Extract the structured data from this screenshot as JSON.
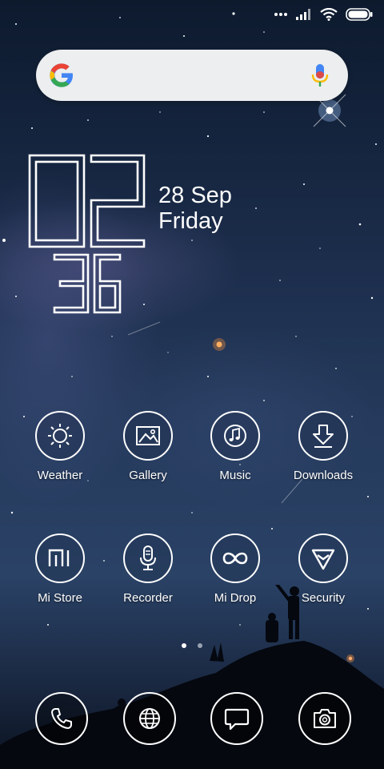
{
  "status_bar": {
    "signal": "signal-icon",
    "wifi": "wifi-icon",
    "battery": "battery-icon"
  },
  "search": {
    "placeholder": "",
    "logo": "google-logo-icon",
    "mic": "mic-icon"
  },
  "clock": {
    "hour": "02",
    "minute": "36",
    "day": "28 Sep",
    "weekday": "Friday"
  },
  "apps_row1": [
    {
      "label": "Weather",
      "icon": "weather-icon"
    },
    {
      "label": "Gallery",
      "icon": "gallery-icon"
    },
    {
      "label": "Music",
      "icon": "music-icon"
    },
    {
      "label": "Downloads",
      "icon": "downloads-icon"
    }
  ],
  "apps_row2": [
    {
      "label": "Mi Store",
      "icon": "mi-store-icon"
    },
    {
      "label": "Recorder",
      "icon": "recorder-icon"
    },
    {
      "label": "Mi Drop",
      "icon": "mi-drop-icon"
    },
    {
      "label": "Security",
      "icon": "security-icon"
    }
  ],
  "page_indicator": {
    "pages": 2,
    "current": 1
  },
  "dock": [
    "phone-icon",
    "browser-icon",
    "messages-icon",
    "camera-icon"
  ]
}
